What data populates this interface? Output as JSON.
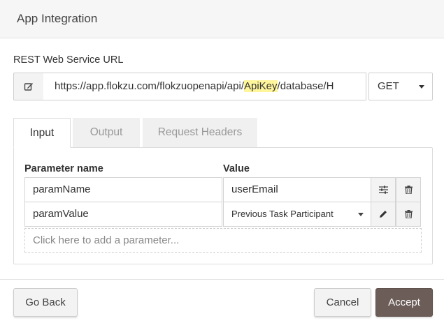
{
  "dialog": {
    "title": "App Integration"
  },
  "url": {
    "label": "REST Web Service URL",
    "prefix": "https://app.flokzu.com/flokzuopenapi/api/",
    "highlight": "ApiKey",
    "suffix": "/database/H",
    "method": "GET"
  },
  "tabs": [
    {
      "label": "Input",
      "active": true
    },
    {
      "label": "Output",
      "active": false
    },
    {
      "label": "Request Headers",
      "active": false
    }
  ],
  "params": {
    "headers": {
      "name": "Parameter name",
      "value": "Value"
    },
    "rows": [
      {
        "name": "paramName",
        "value": "userEmail",
        "action_icon": "sliders-icon",
        "remove_icon": "trash-icon"
      },
      {
        "name": "paramValue",
        "value": "Previous Task Participant",
        "action_icon": "pencil-icon",
        "remove_icon": "trash-icon"
      }
    ],
    "add_placeholder": "Click here to add a parameter..."
  },
  "footer": {
    "back_label": "Go Back",
    "cancel_label": "Cancel",
    "accept_label": "Accept"
  },
  "colors": {
    "accent": "#6c5d58",
    "highlight": "#fff59a"
  }
}
